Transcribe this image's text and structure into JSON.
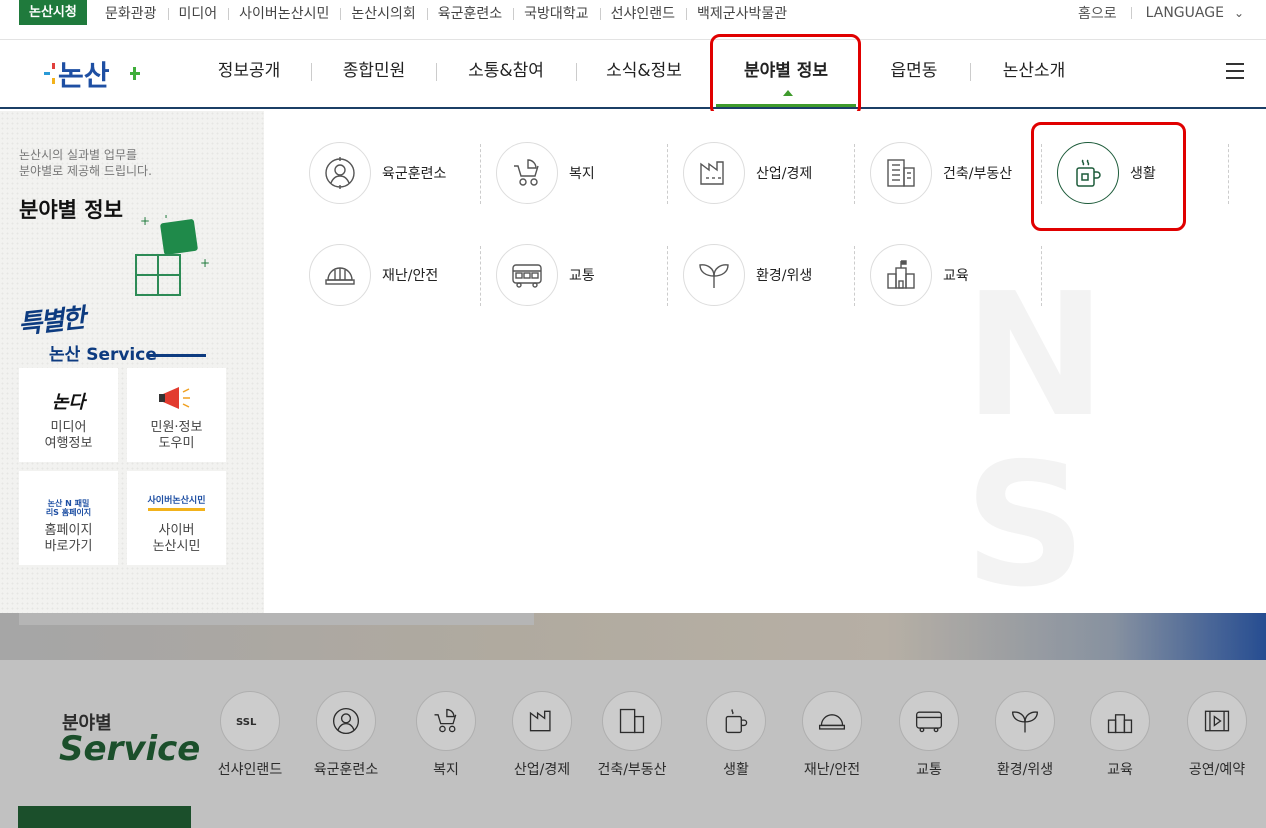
{
  "topbar": {
    "badge": "논산시청",
    "links": [
      "문화관광",
      "미디어",
      "사이버논산시민",
      "논산시의회",
      "육군훈련소",
      "국방대학교",
      "선샤인랜드",
      "백제군사박물관"
    ],
    "home": "홈으로",
    "language": "LANGUAGE"
  },
  "logo": {
    "text": "논산"
  },
  "nav": {
    "items": [
      "정보공개",
      "종합민원",
      "소통&참여",
      "소식&정보",
      "분야별 정보",
      "읍면동",
      "논산소개"
    ],
    "active": "분야별 정보"
  },
  "left_panel": {
    "desc": "논산시의 실과별 업무를\n분야별로 제공해 드립니다.",
    "title": "분야별 정보",
    "special_script": "특별한",
    "special_sub": "논산 Service",
    "cards": [
      {
        "icon_text": "논다",
        "label": "미디어\n여행정보"
      },
      {
        "icon": "megaphone-icon",
        "label": "민원·정보\n도우미"
      },
      {
        "icon_text": "논산 N 패밀리S 홈페이지",
        "label": "홈페이지\n바로가기"
      },
      {
        "icon_text": "사이버논산시민",
        "label": "사이버\n논산시민"
      }
    ]
  },
  "mega_menu": {
    "row1": [
      {
        "label": "육군훈련소",
        "icon": "soldier-icon"
      },
      {
        "label": "복지",
        "icon": "stroller-icon"
      },
      {
        "label": "산업/경제",
        "icon": "factory-icon"
      },
      {
        "label": "건축/부동산",
        "icon": "building-icon"
      },
      {
        "label": "생활",
        "icon": "mug-icon",
        "active": true
      }
    ],
    "row2": [
      {
        "label": "재난/안전",
        "icon": "helmet-icon"
      },
      {
        "label": "교통",
        "icon": "bus-icon"
      },
      {
        "label": "환경/위생",
        "icon": "sprout-icon"
      },
      {
        "label": "교육",
        "icon": "school-icon"
      }
    ]
  },
  "bottom_services": {
    "title_ko": "분야별",
    "title_en": "Service",
    "items": [
      "선샤인랜드",
      "육군훈련소",
      "복지",
      "산업/경제",
      "건축/부동산",
      "생활",
      "재난/안전",
      "교통",
      "환경/위생",
      "교육",
      "공연/예약"
    ]
  },
  "colors": {
    "primary_green": "#1f7a3c",
    "nav_active": "#3f9b2c",
    "navy": "#0d3b80",
    "highlight": "#e00000"
  }
}
